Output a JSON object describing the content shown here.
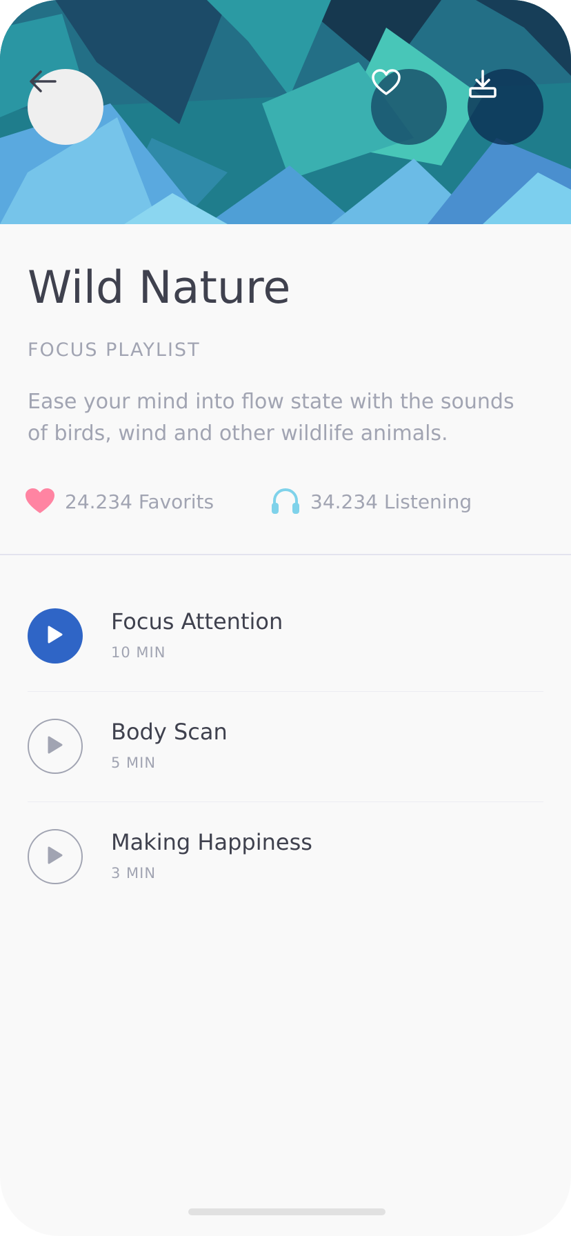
{
  "header": {
    "back_icon": "arrow-left-icon",
    "favorite_icon": "heart-outline-icon",
    "download_icon": "download-icon"
  },
  "playlist": {
    "title": "Wild Nature",
    "category": "FOCUS PLAYLIST",
    "description": "Ease your mind into flow state with the sounds of birds, wind and other wildlife animals."
  },
  "stats": {
    "favorites": "24.234 Favorits",
    "favorites_icon": "heart-icon",
    "favorites_color": "#ff84a2",
    "listening": "34.234 Listening",
    "listening_icon": "headphones-icon",
    "listening_color": "#7fd2ea"
  },
  "tracks": [
    {
      "name": "Focus Attention",
      "duration": "10 MIN",
      "active": true
    },
    {
      "name": "Body Scan",
      "duration": "5 MIN",
      "active": false
    },
    {
      "name": "Making Happiness",
      "duration": "3 MIN",
      "active": false
    }
  ],
  "colors": {
    "accent": "#2f65c6",
    "text_primary": "#3f414e",
    "text_secondary": "#a1a4b2",
    "background": "#f9f9f9"
  }
}
